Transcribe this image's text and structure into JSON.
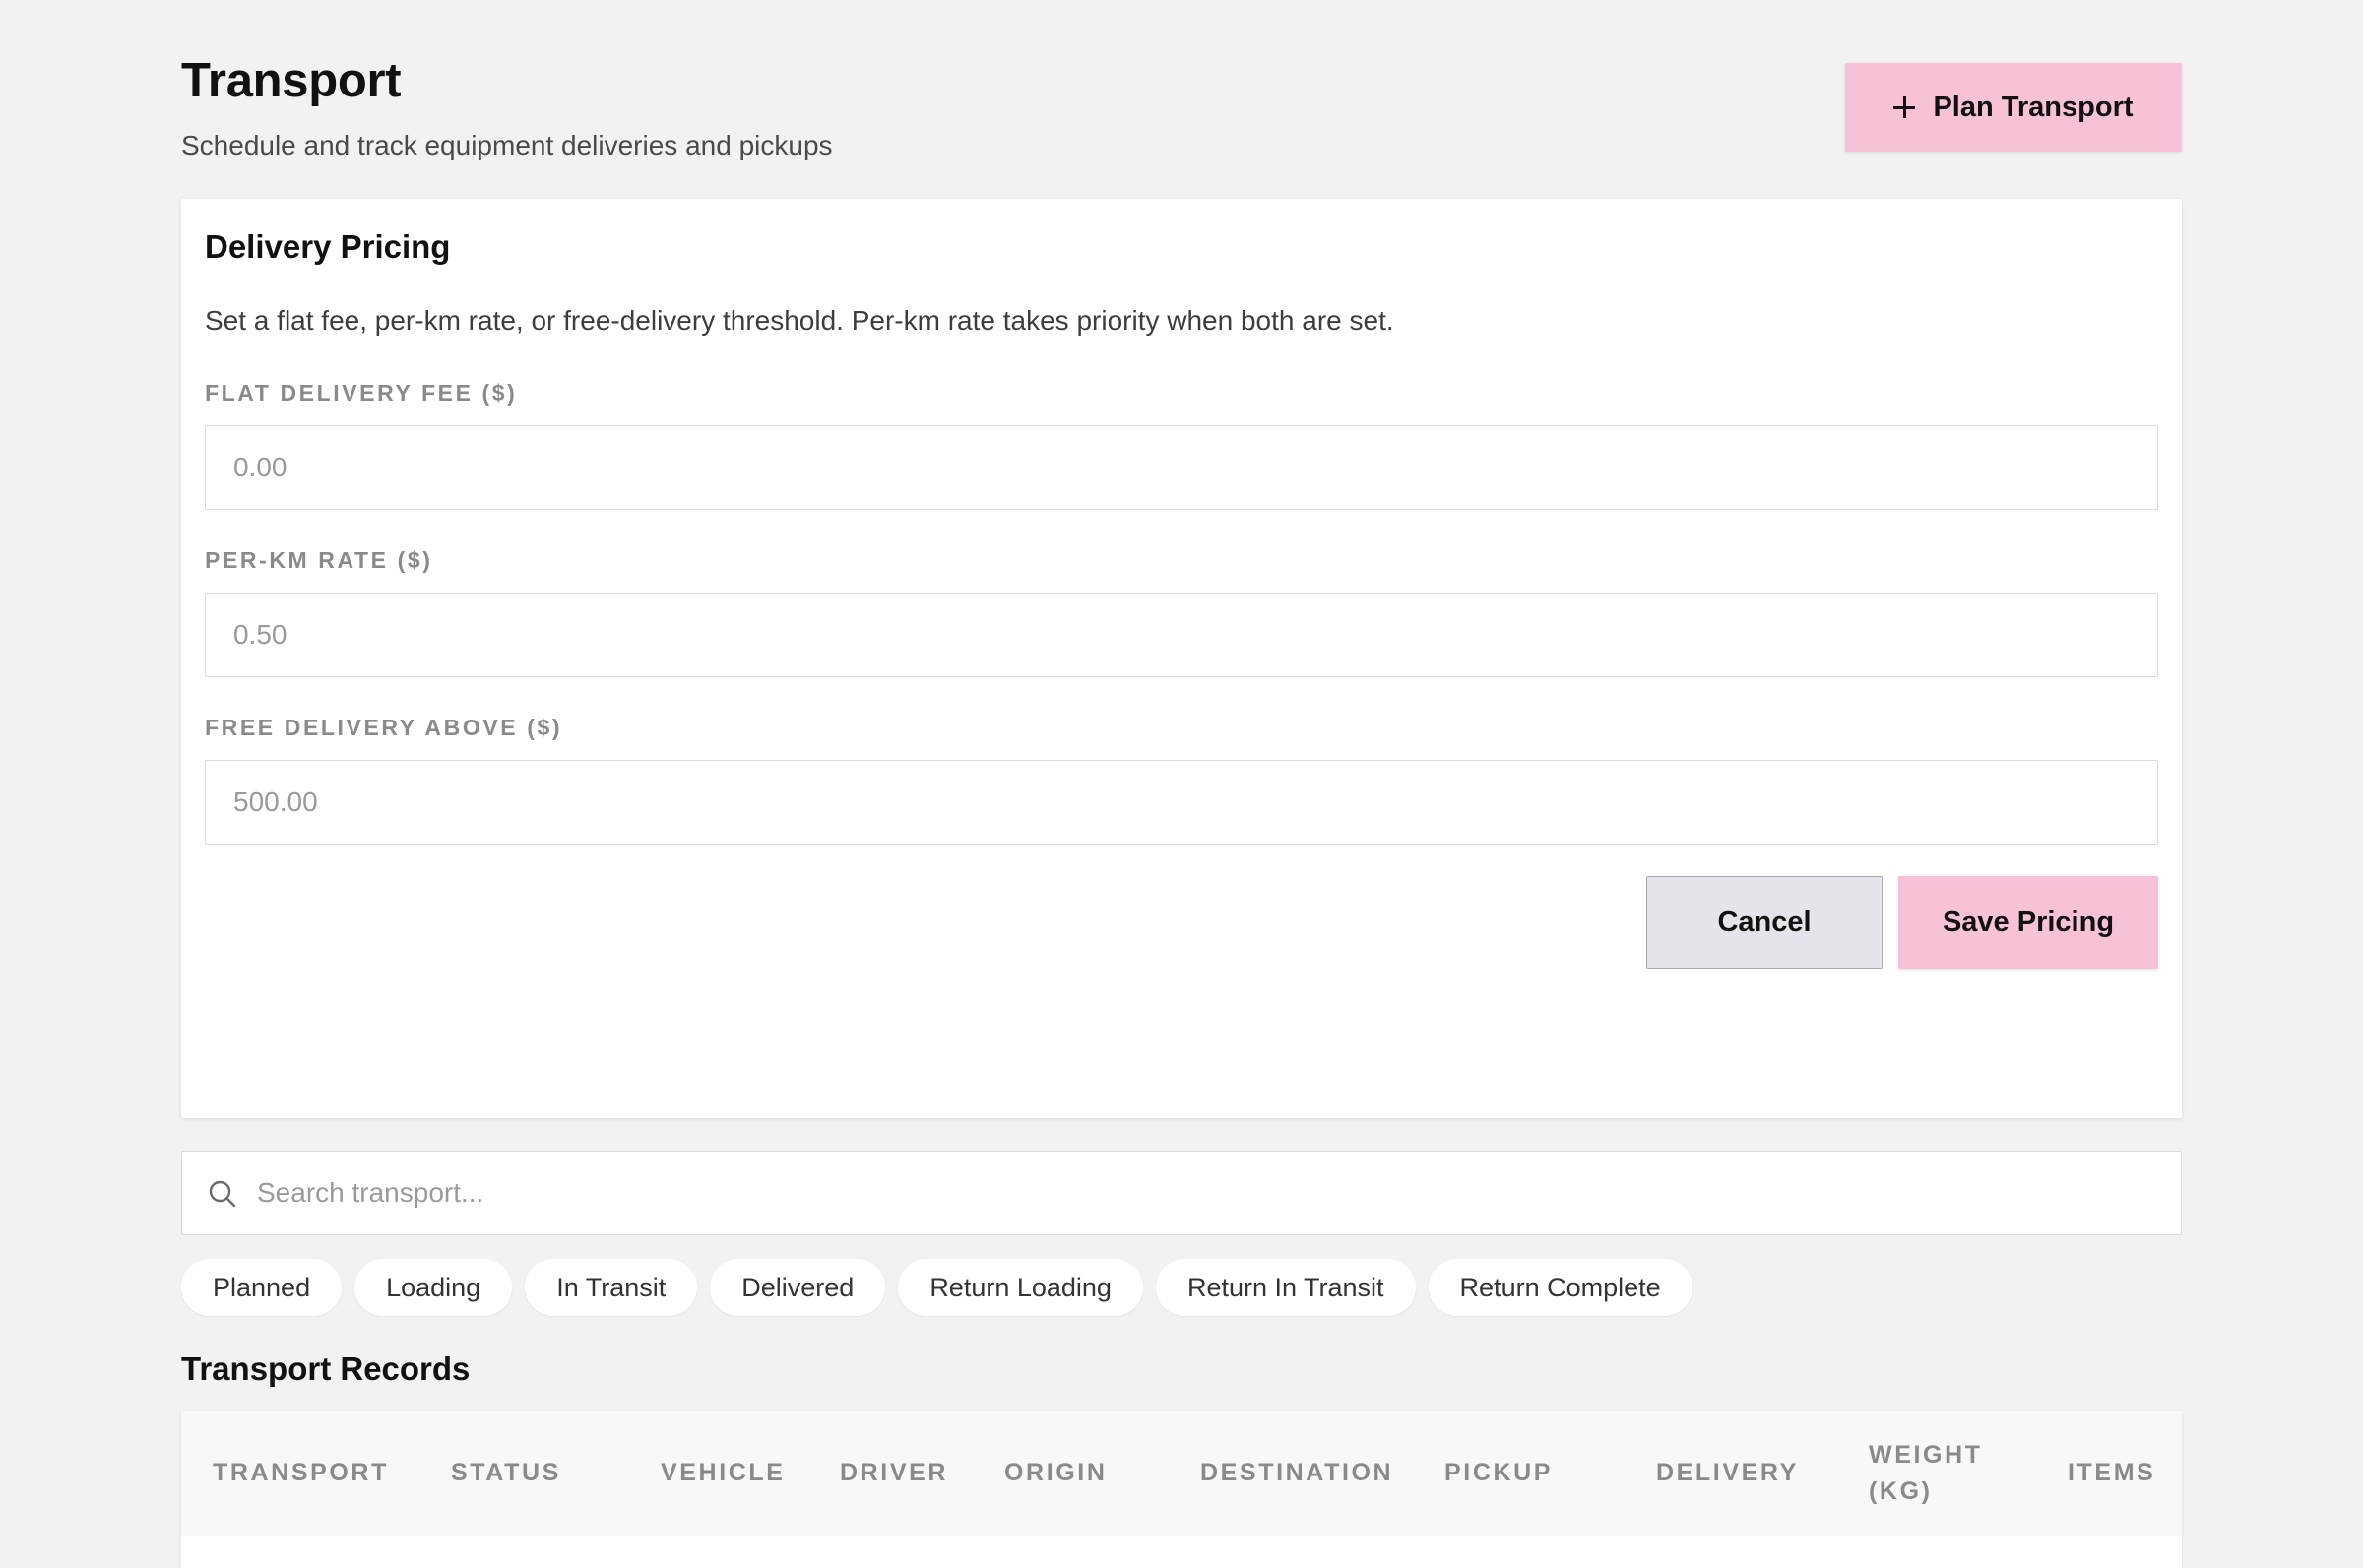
{
  "header": {
    "title": "Transport",
    "subtitle": "Schedule and track equipment deliveries and pickups",
    "plan_button_label": "Plan Transport"
  },
  "pricing": {
    "title": "Delivery Pricing",
    "description": "Set a flat fee, per-km rate, or free-delivery threshold. Per-km rate takes priority when both are set.",
    "fields": [
      {
        "label": "FLAT DELIVERY FEE ($)",
        "value": "",
        "placeholder": "0.00"
      },
      {
        "label": "PER-KM RATE ($)",
        "value": "",
        "placeholder": "0.50"
      },
      {
        "label": "FREE DELIVERY ABOVE ($)",
        "value": "",
        "placeholder": "500.00"
      }
    ],
    "cancel_label": "Cancel",
    "save_label": "Save Pricing"
  },
  "search": {
    "placeholder": "Search transport..."
  },
  "filters": [
    "Planned",
    "Loading",
    "In Transit",
    "Delivered",
    "Return Loading",
    "Return In Transit",
    "Return Complete"
  ],
  "records": {
    "title": "Transport Records",
    "columns": [
      "TRANSPORT",
      "STATUS",
      "VEHICLE",
      "DRIVER",
      "ORIGIN",
      "DESTINATION",
      "PICKUP",
      "DELIVERY",
      "WEIGHT (KG)",
      "ITEMS"
    ]
  },
  "colors": {
    "accent": "#f7c1d8",
    "background": "#f2f2f2",
    "cancel_bg": "#e3e5ea"
  },
  "icons": [
    "plus-icon",
    "search-icon"
  ]
}
